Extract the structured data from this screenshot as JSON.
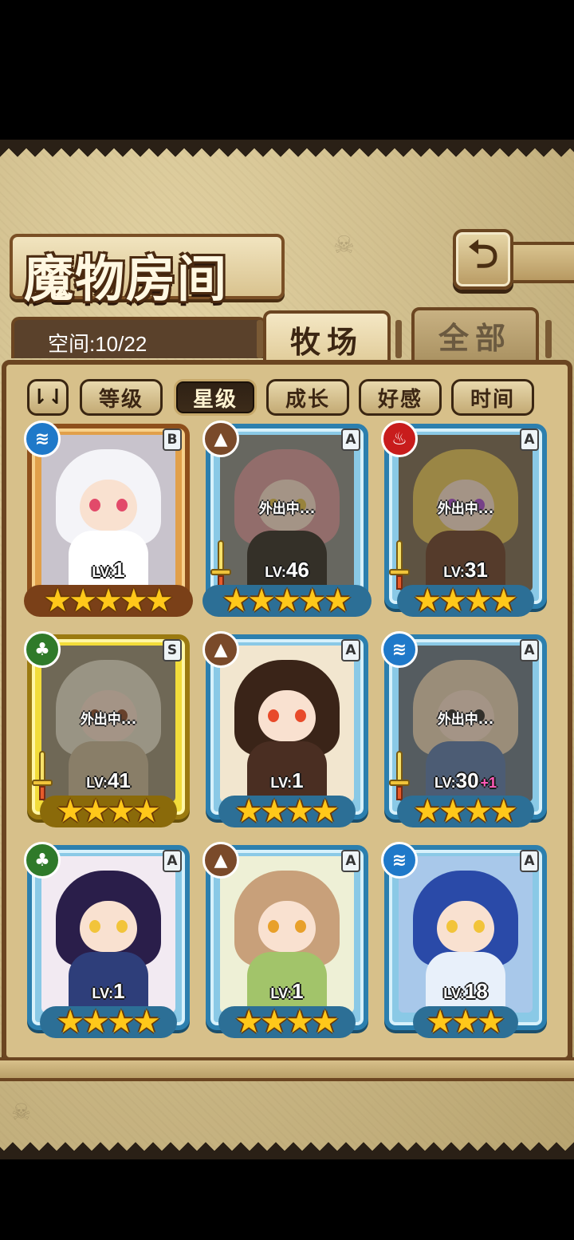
{
  "title": "魔物房间",
  "back_button_icon": "back-arrow-icon",
  "space_label": "空间:10/22",
  "tabs": [
    {
      "label": "牧场",
      "active": true
    },
    {
      "label": "全部",
      "active": false
    }
  ],
  "sort_toggle_label": "⇂⇃",
  "filters": [
    {
      "label": "等级",
      "active": false
    },
    {
      "label": "星级",
      "active": true
    },
    {
      "label": "成长",
      "active": false
    },
    {
      "label": "好感",
      "active": false
    },
    {
      "label": "时间",
      "active": false
    }
  ],
  "away_text": "外出中...",
  "lv_prefix": "LV:",
  "monsters": [
    {
      "element": "water",
      "element_icon": "≋",
      "rank": "B",
      "level": "1",
      "stars": 5,
      "away": false,
      "equipped": false,
      "bonus": "",
      "hair": "#f4f4f8",
      "body": "#ffffff",
      "eye": "#e24a6a",
      "bg": "#c8c3cc"
    },
    {
      "element": "earth",
      "element_icon": "▲",
      "rank": "A",
      "level": "46",
      "stars": 5,
      "away": true,
      "equipped": true,
      "bonus": "",
      "hair": "#d99a9e",
      "body": "#2f2a26",
      "eye": "#e3c24a",
      "bg": "#8a8e8a"
    },
    {
      "element": "fire",
      "element_icon": "♨",
      "rank": "A",
      "level": "31",
      "stars": 4,
      "away": true,
      "equipped": true,
      "bonus": "",
      "hair": "#e8c65a",
      "body": "#6b3f2a",
      "eye": "#a64ad4",
      "bg": "#7a6a55"
    },
    {
      "element": "wood",
      "element_icon": "♣",
      "rank": "S",
      "level": "41",
      "stars": 4,
      "away": true,
      "equipped": true,
      "bonus": "",
      "hair": "#e6e0cc",
      "body": "#c9b89a",
      "eye": "#8a4a2a",
      "bg": "#9a9078"
    },
    {
      "element": "earth",
      "element_icon": "▲",
      "rank": "A",
      "level": "1",
      "stars": 4,
      "away": false,
      "equipped": false,
      "bonus": "",
      "hair": "#3a2418",
      "body": "#4a2e22",
      "eye": "#e84a2a",
      "bg": "#f2e6cf"
    },
    {
      "element": "water",
      "element_icon": "≋",
      "rank": "A",
      "level": "30",
      "stars": 4,
      "away": true,
      "equipped": true,
      "bonus": "+1",
      "hair": "#e8d4b8",
      "body": "#5a7ab0",
      "eye": "#2a2a2a",
      "bg": "#6a7a8a"
    },
    {
      "element": "wood",
      "element_icon": "♣",
      "rank": "A",
      "level": "1",
      "stars": 4,
      "away": false,
      "equipped": false,
      "bonus": "",
      "hair": "#2a1e4a",
      "body": "#2e3e7a",
      "eye": "#f2c43a",
      "bg": "#f2eaf2"
    },
    {
      "element": "earth",
      "element_icon": "▲",
      "rank": "A",
      "level": "1",
      "stars": 4,
      "away": false,
      "equipped": false,
      "bonus": "",
      "hair": "#c8a07a",
      "body": "#a2c46a",
      "eye": "#e8a02a",
      "bg": "#eef0d6"
    },
    {
      "element": "water",
      "element_icon": "≋",
      "rank": "A",
      "level": "18",
      "stars": 3,
      "away": false,
      "equipped": false,
      "bonus": "",
      "hair": "#2a4aa8",
      "body": "#e8f0fa",
      "eye": "#f2c43a",
      "bg": "#a8c8ea"
    }
  ]
}
